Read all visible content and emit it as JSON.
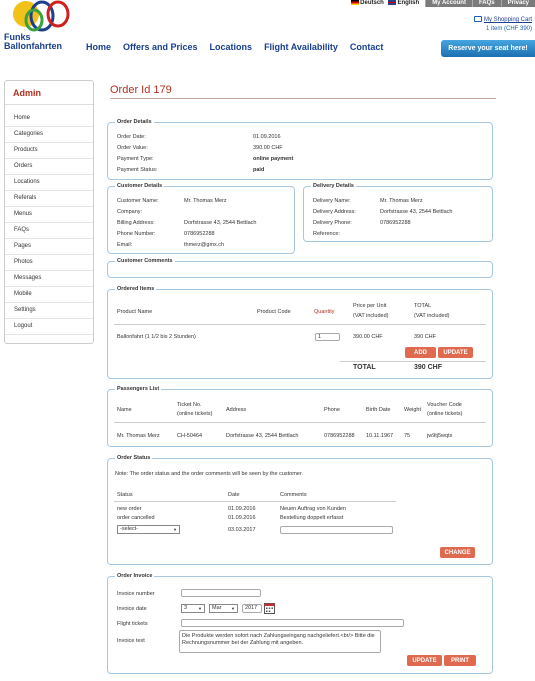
{
  "header": {
    "logo_text_1": "Funks",
    "logo_text_2": "Ballonfahrten",
    "lang_de": "Deutsch",
    "lang_en": "English",
    "top_links": [
      "My Account",
      "FAQs",
      "Privacy"
    ],
    "cart_title": "My Shopping Cart",
    "cart_summary": "1 item (CHF 390)",
    "reserve_button": "Reserve your seat here!",
    "nav": [
      "Home",
      "Offers and Prices",
      "Locations",
      "Flight Availability",
      "Contact"
    ]
  },
  "sidebar": {
    "title": "Admin",
    "items": [
      "Home",
      "Categories",
      "Products",
      "Orders",
      "Locations",
      "Referals",
      "Menus",
      "FAQs",
      "Pages",
      "Photos",
      "Messages",
      "Mobile",
      "Settings",
      "Logout"
    ]
  },
  "order": {
    "title": "Order Id 179",
    "details": {
      "legend": "Order Details",
      "labels": [
        "Order Date:",
        "Order Value:",
        "Payment Type:",
        "Payment Status:"
      ],
      "values": [
        "01.09.2016",
        "390.00 CHF",
        "online payment",
        "paid"
      ]
    },
    "customer": {
      "legend": "Customer Details",
      "labels": [
        "Customer Name:",
        "Company:",
        "Billing Address:",
        "Phone Number:",
        "Email:"
      ],
      "values": [
        "Mr. Thomas Merz",
        "",
        "Dorfstrasse 43, 2544 Bettlach",
        "0786952288",
        "thmerz@gmx.ch"
      ]
    },
    "delivery": {
      "legend": "Delivery Details",
      "labels": [
        "Delivery Name:",
        "Delivery Address:",
        "Delivery Phone:",
        "Reference:"
      ],
      "values": [
        "Mr. Thomas Merz",
        "Dorfstrasse 43, 2544 Bettlach",
        "0786952288",
        ""
      ]
    },
    "comments": {
      "legend": "Customer Comments"
    },
    "items": {
      "legend": "Ordered Items",
      "headers": [
        "Product Name",
        "Product Code",
        "Quantity",
        "Price per Unit",
        "(VAT included)",
        "TOTAL",
        "(VAT included)"
      ],
      "row": {
        "name": "Ballonfahrt (1 1/2 bis 2 Stunden)",
        "code": "",
        "qty": "1",
        "price": "390.00 CHF",
        "total": "390 CHF"
      },
      "add_button": "ADD",
      "update_button": "UPDATE",
      "total_label": "TOTAL",
      "total_value": "390 CHF"
    },
    "passengers": {
      "legend": "Passengers List",
      "headers": [
        "Name",
        "Ticket No.",
        "(online tickets)",
        "Address",
        "Phone",
        "Birth Date",
        "Weight",
        "Voucher Code",
        "(online tickets)"
      ],
      "row": {
        "name": "Mr. Thomas Merz",
        "ticket": "CH-50464",
        "address": "Dorfstrasse 43, 2544 Bettlach",
        "phone": "0786952288",
        "birth": "10.11.1967",
        "weight": "75",
        "voucher": "jw9tj5wqtx"
      }
    },
    "status": {
      "legend": "Order Status",
      "note": "Note: The order status and the order comments will be seen by the customer.",
      "headers": [
        "Status",
        "Date",
        "Comments"
      ],
      "rows": [
        {
          "status": "new order",
          "date": "01.09.2016",
          "comment": "Neuen Auftrag von Kunden"
        },
        {
          "status": "order cancelled",
          "date": "01.09.2016",
          "comment": "Bestellung doppelt erfasst"
        }
      ],
      "select_value": "-select-",
      "new_date": "03.03.2017",
      "change_button": "CHANGE"
    },
    "invoice": {
      "legend": "Order Invoice",
      "labels": [
        "Invoice number",
        "Invoice date",
        "Flight tickets",
        "Invoice text"
      ],
      "day": "3",
      "month": "Mar",
      "year": "2017",
      "text": "Die Produkte werden sofort nach Zahlungseingang nachgeliefert.<br/> Bitte die Rechnungsnummer bei der Zahlung mit angeben.",
      "update_button": "UPDATE",
      "print_button": "PRINT"
    }
  },
  "colors": {
    "accent": "#b03020",
    "nav": "#1a3f8f",
    "button": "#e06a50",
    "border": "#a8c8e0"
  }
}
